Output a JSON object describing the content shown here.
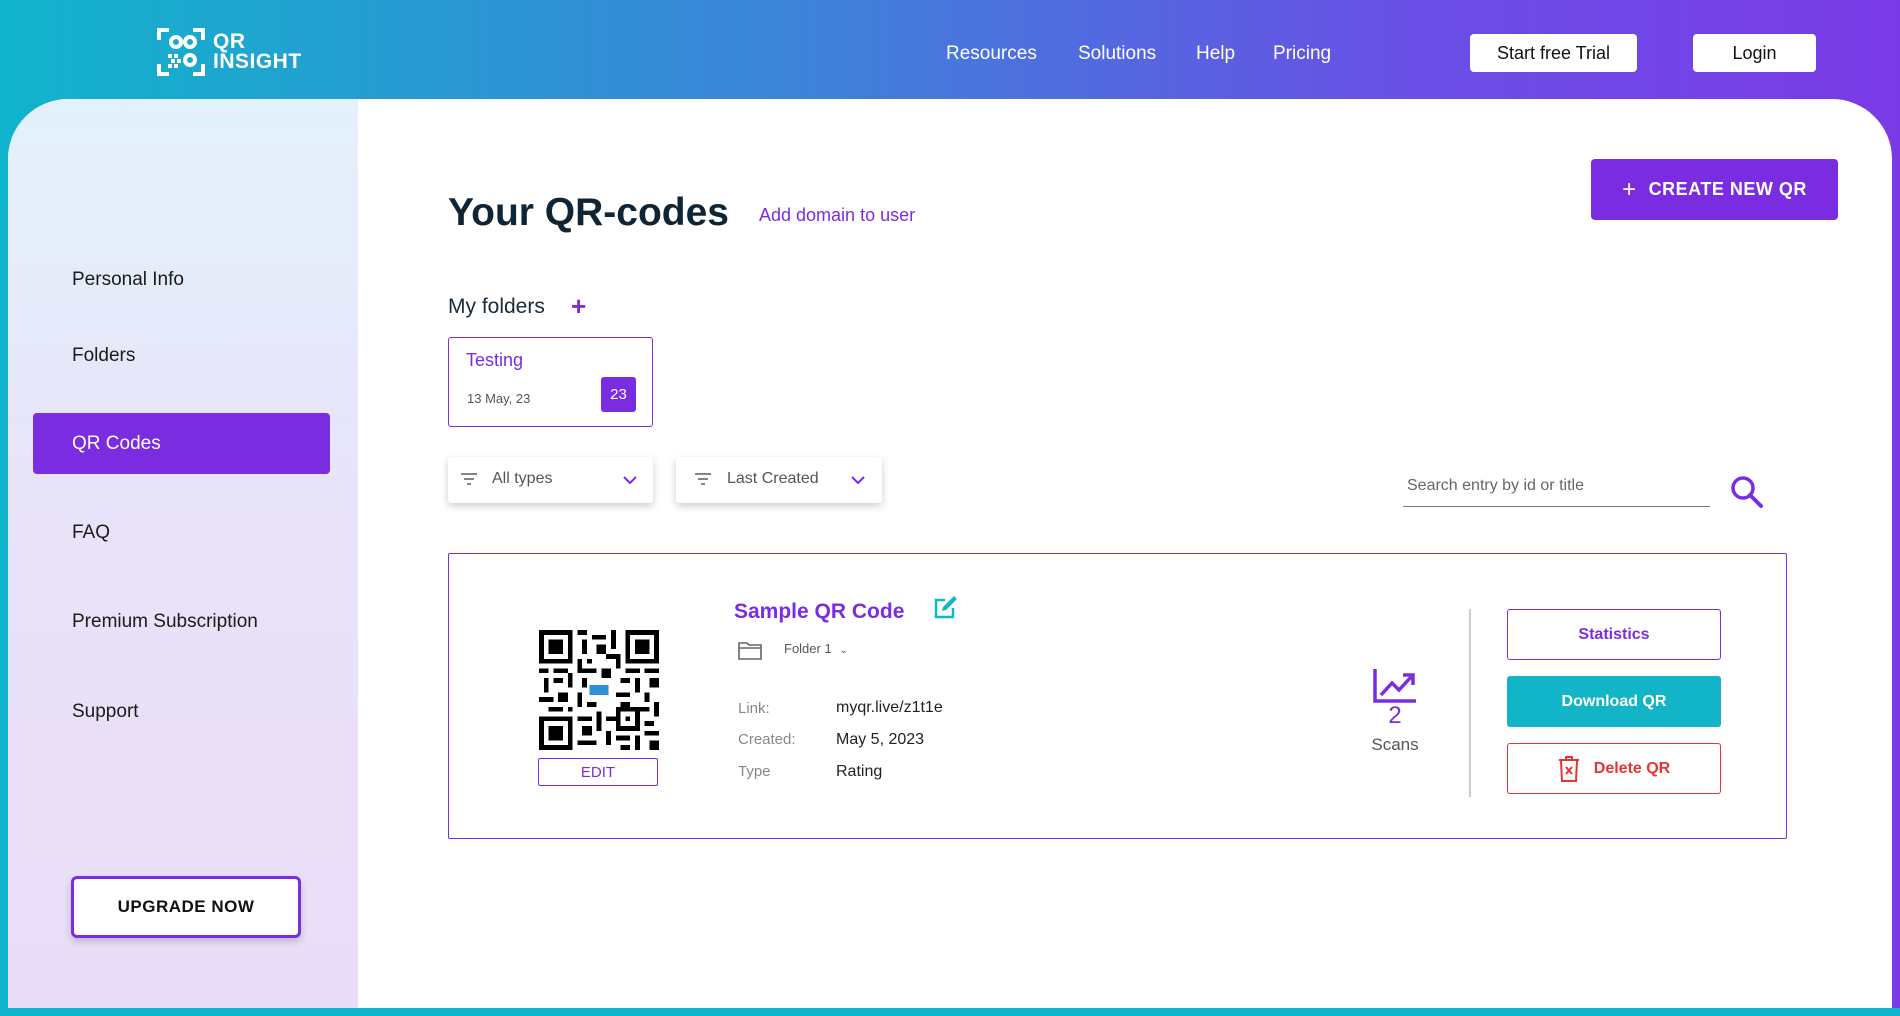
{
  "brand": {
    "logo_line1": "QR",
    "logo_line2": "INSIGHT"
  },
  "nav": {
    "links": [
      "Resources",
      "Solutions",
      "Help",
      "Pricing"
    ],
    "trial_label": "Start free Trial",
    "login_label": "Login"
  },
  "sidebar": {
    "items": [
      "Personal Info",
      "Folders",
      "QR Codes",
      "FAQ",
      "Premium Subscription",
      "Support"
    ],
    "active": "QR Codes",
    "upgrade_label": "UPGRADE NOW"
  },
  "main": {
    "title": "Your QR-codes",
    "add_domain": "Add domain to user",
    "create_label": "CREATE NEW QR",
    "folders_title": "My folders",
    "folder": {
      "name": "Testing",
      "date": "13 May, 23",
      "count": "23"
    },
    "filters": {
      "type": "All types",
      "sort": "Last Created"
    },
    "search_placeholder": "Search entry by id or title"
  },
  "qr": {
    "name": "Sample QR Code",
    "folder": "Folder 1",
    "edit_label": "EDIT",
    "link_label": "Link:",
    "link": "myqr.live/z1t1e",
    "created_label": "Created:",
    "created": "May 5, 2023",
    "type_label": "Type",
    "type": "Rating",
    "scans": "2",
    "scans_label": "Scans",
    "statistics_label": "Statistics",
    "download_label": "Download QR",
    "delete_label": "Delete QR"
  },
  "colors": {
    "accent": "#7a2de0",
    "teal": "#12b5c8",
    "danger": "#e53535"
  }
}
